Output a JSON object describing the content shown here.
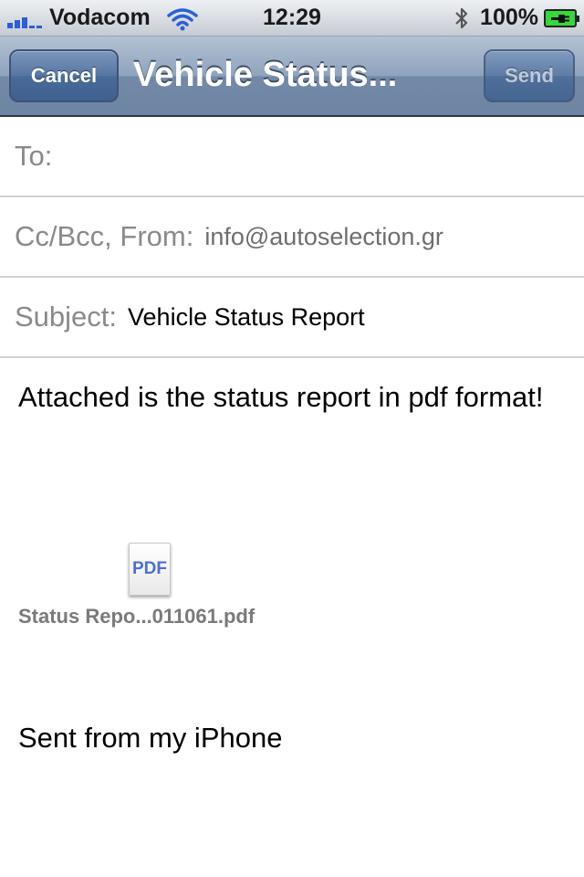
{
  "status_bar": {
    "carrier": "Vodacom",
    "time": "12:29",
    "battery_percent": "100%",
    "signal_bars": 3
  },
  "nav": {
    "cancel_label": "Cancel",
    "title": "Vehicle Status...",
    "send_label": "Send"
  },
  "fields": {
    "to_label": "To:",
    "to_value": "",
    "ccbcc_label": "Cc/Bcc, From:",
    "from_value": "info@autoselection.gr",
    "subject_label": "Subject:",
    "subject_value": "Vehicle Status Report"
  },
  "body": {
    "message": "Attached is the status report in pdf format!",
    "signature": "Sent from my iPhone"
  },
  "attachment": {
    "icon_text": "PDF",
    "filename": "Status Repo...011061.pdf"
  },
  "colors": {
    "nav_blue": "#6d84a3",
    "button_blue": "#4a6b98",
    "pdf_blue": "#4c6ed6",
    "battery_green": "#37d83a"
  }
}
